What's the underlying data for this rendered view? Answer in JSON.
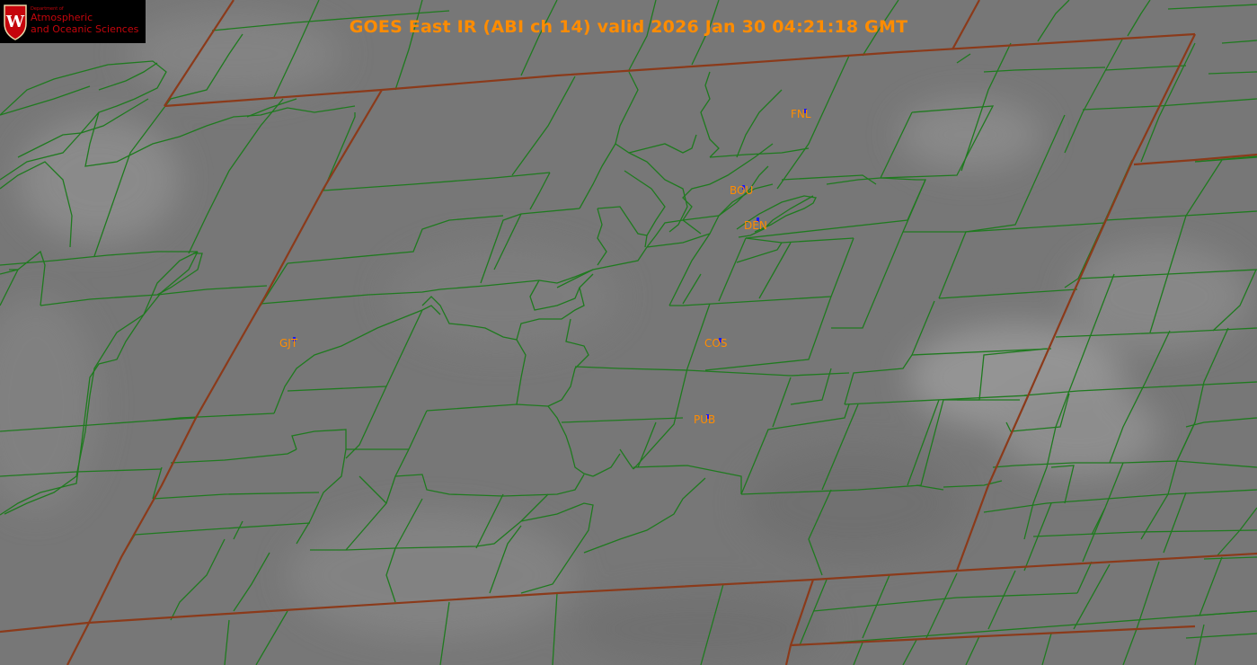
{
  "title": "GOES East IR (ABI ch 14) valid 2026 Jan 30 04:21:18 GMT",
  "logo": {
    "department": "Department of",
    "line1": "Atmospheric",
    "line2": "and Oceanic Sciences",
    "crest_letter": "W"
  },
  "stations": [
    {
      "id": "fnl",
      "label": "FNL"
    },
    {
      "id": "bou",
      "label": "BOU"
    },
    {
      "id": "den",
      "label": "DEN"
    },
    {
      "id": "gjt",
      "label": "GJT"
    },
    {
      "id": "cos",
      "label": "COS"
    },
    {
      "id": "pub",
      "label": "PUB"
    }
  ],
  "colors": {
    "state_border": "#8b3a1a",
    "county_border": "#1f7a1f",
    "station_label": "#ff8c00",
    "station_marker": "#1a1aff",
    "title": "#ff8c00",
    "logo_red": "#c5050c"
  }
}
